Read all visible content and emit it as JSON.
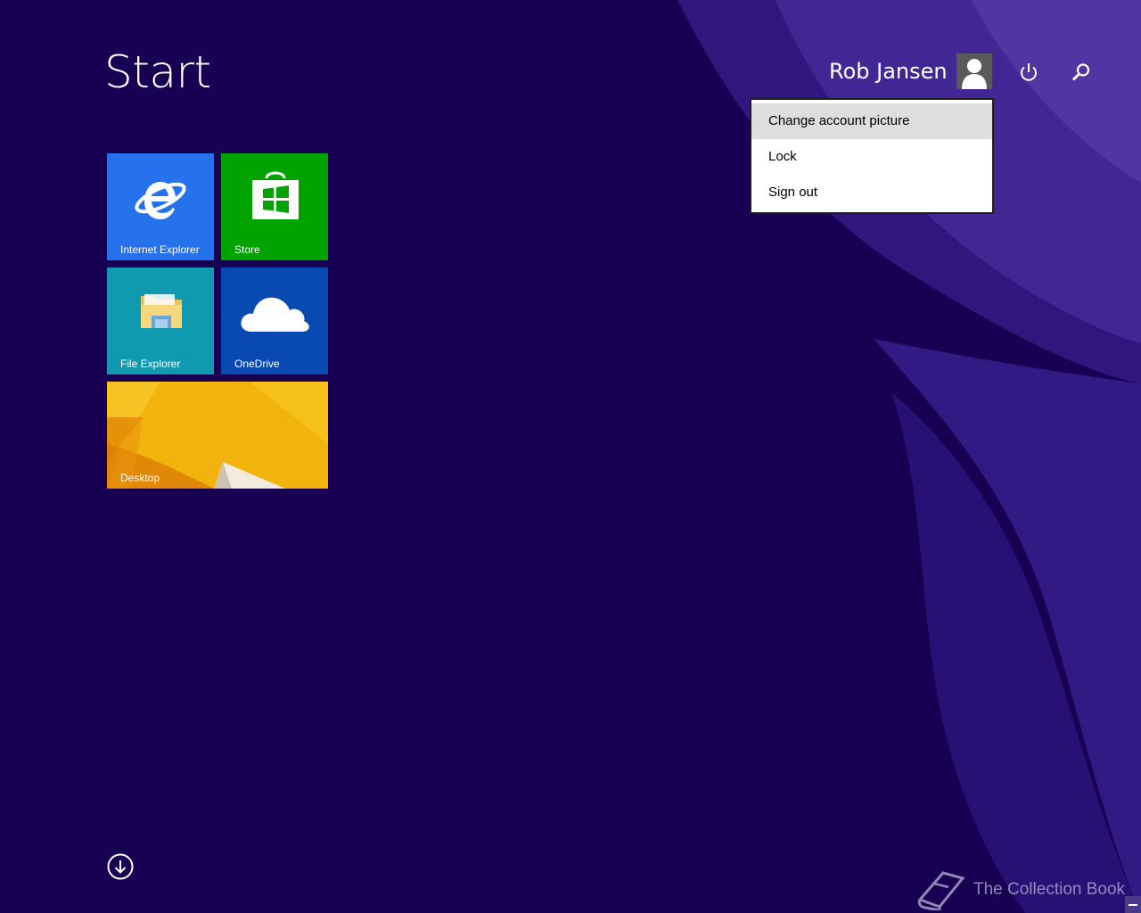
{
  "screen": {
    "title": "Start"
  },
  "user": {
    "name": "Rob Jansen"
  },
  "account_menu": {
    "items": [
      {
        "label": "Change account picture",
        "highlighted": true
      },
      {
        "label": "Lock",
        "highlighted": false
      },
      {
        "label": "Sign out",
        "highlighted": false
      }
    ]
  },
  "tiles": [
    {
      "label": "Internet Explorer",
      "color": "#2672ec",
      "icon": "internet-explorer-icon"
    },
    {
      "label": "Store",
      "color": "#00a300",
      "icon": "store-icon"
    },
    {
      "label": "File Explorer",
      "color": "#0f9aaf",
      "icon": "folder-icon"
    },
    {
      "label": "OneDrive",
      "color": "#094ab2",
      "icon": "cloud-icon"
    },
    {
      "label": "Desktop",
      "color": "#f0a30a",
      "icon": "desktop-wallpaper"
    }
  ],
  "top_icons": [
    "power-icon",
    "search-icon"
  ],
  "footer": {
    "apps_button_icon": "down-arrow-circle-icon",
    "watermark": "The Collection Book"
  },
  "colors": {
    "background": "#180052",
    "swoosh": "#4a2fa0"
  }
}
